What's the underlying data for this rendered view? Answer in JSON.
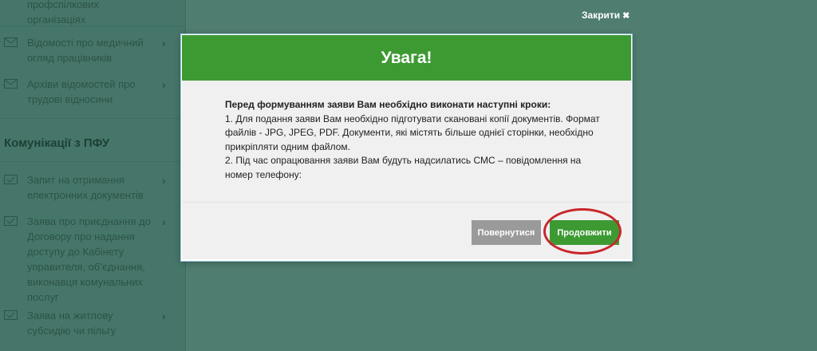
{
  "sidebar": {
    "items_top": [
      {
        "label": "профспілкових організаціях",
        "icon": "envelope-icon"
      },
      {
        "label": "Відомості про медичний огляд працівників",
        "icon": "envelope-icon"
      },
      {
        "label": "Архіви відомостей про трудові відносини",
        "icon": "envelope-icon"
      }
    ],
    "section_title": "Комунікації з ПФУ",
    "items_bottom": [
      {
        "label": "Запит на отримання електронних документів",
        "icon": "document-check-icon"
      },
      {
        "label": "Заява про приєднання до Договору про надання доступу до Кабінету управителя, об’єднання, виконавця комунальних послуг",
        "icon": "document-check-icon"
      },
      {
        "label": "Заява на житлову субсидію чи пільгу",
        "icon": "document-check-icon"
      }
    ]
  },
  "close_link": {
    "label": "Закрити",
    "icon": "✖"
  },
  "modal": {
    "title": "Увага!",
    "lead": "Перед формуванням заяви Вам необхідно виконати наступні кроки:",
    "step1": "1. Для подання заяви Вам необхідно підготувати скановані копії документів. Формат файлів - JPG, JPEG, PDF. Документи, які містять більше однієї сторінки, необхідно прикріпляти одним файлом.",
    "step2": "2. Під час опрацювання заяви Вам будуть надсилатись СМС – повідомлення на номер телефону:",
    "back_label": "Повернутися",
    "continue_label": "Продовжити"
  },
  "colors": {
    "header_green": "#3d9a33",
    "button_gray": "#9a9a9a",
    "highlight_red": "#c9262c",
    "overlay": "#4f7d70"
  }
}
